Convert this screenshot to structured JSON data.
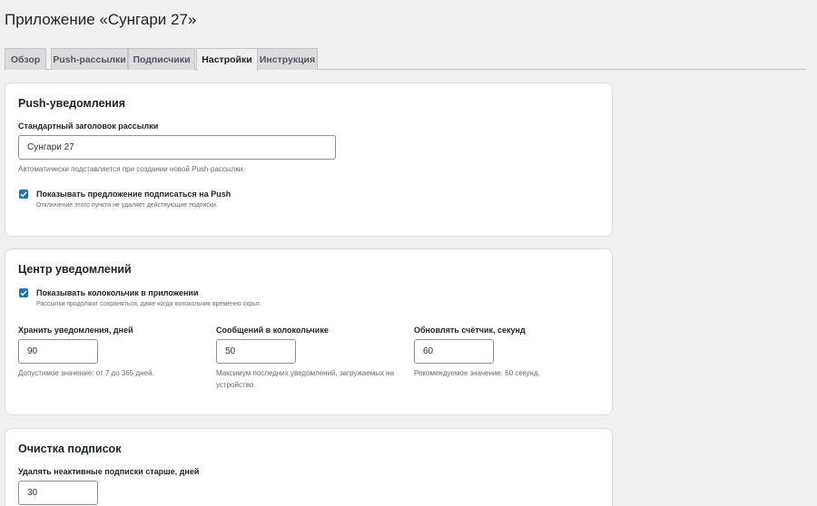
{
  "page": {
    "title": "Приложение «Сунгари 27»"
  },
  "tabs": [
    {
      "label": "Обзор"
    },
    {
      "label": "Push-рассылки"
    },
    {
      "label": "Подписчики"
    },
    {
      "label": "Настройки",
      "active": true
    },
    {
      "label": "Инструкция"
    }
  ],
  "push": {
    "title": "Push-уведомления",
    "header_label": "Стандартный заголовок рассылки",
    "header_value": "Сунгари 27",
    "header_hint": "Автоматически подставляется при создании новой Push-рассылки.",
    "offer_checked": true,
    "offer_label": "Показывать предложение подписаться на Push",
    "offer_hint": "Отключение этого пункта не удаляет действующие подписки."
  },
  "center": {
    "title": "Центр уведомлений",
    "bell_checked": true,
    "bell_label": "Показывать колокольчик в приложении",
    "bell_hint": "Рассылки продолжат сохраняться, даже когда колокольчик временно скрыт.",
    "fields": [
      {
        "label": "Хранить уведомления, дней",
        "value": "90",
        "hint": "Допустимое значение: от 7 до 365 дней."
      },
      {
        "label": "Сообщений в колокольчике",
        "value": "50",
        "hint": "Максимум последних уведомлений, загружаемых на устройство."
      },
      {
        "label": "Обновлять счётчик, секунд",
        "value": "60",
        "hint": "Рекомендуемое значение: 60 секунд."
      }
    ]
  },
  "cleanup": {
    "title": "Очистка подписок",
    "label": "Удалять неактивные подписки старше, дней",
    "value": "30"
  },
  "colors": {
    "accent": "#2271b1",
    "background": "#f0f0f1"
  },
  "icons": {
    "checkbox": "checkmark-icon"
  }
}
